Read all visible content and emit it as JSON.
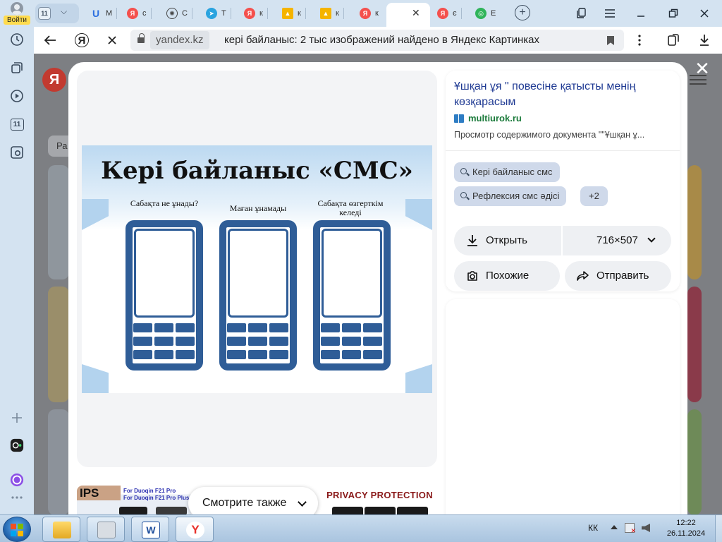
{
  "sidebar": {
    "login_label": "Войти",
    "badge_label": "11"
  },
  "tabs": {
    "first_count": "11",
    "items": [
      {
        "fav": "U",
        "label": "M",
        "style": "fav-u"
      },
      {
        "fav": "Я",
        "label": "с",
        "style": "fav-ya"
      },
      {
        "fav": "✺",
        "label": "C",
        "style": "fav-gpt"
      },
      {
        "fav": "➤",
        "label": "T",
        "style": "fav-tg"
      },
      {
        "fav": "Я",
        "label": "к",
        "style": "fav-ya"
      },
      {
        "fav": "▲",
        "label": "к",
        "style": "fav-img"
      },
      {
        "fav": "▲",
        "label": "к",
        "style": "fav-img"
      },
      {
        "fav": "Я",
        "label": "к",
        "style": "fav-ya"
      }
    ],
    "after_active": [
      {
        "fav": "Я",
        "label": "є",
        "style": "fav-ya"
      },
      {
        "fav": "◎",
        "label": "Е",
        "style": "fav-green"
      }
    ],
    "new_tab": "+"
  },
  "address": {
    "domain": "yandex.kz",
    "page_title": "кері байланыс: 2 тыс изображений найдено в Яндекс Картинках"
  },
  "page": {
    "filter_pill": "Ра"
  },
  "viewer": {
    "image": {
      "title": "Кері байланыс «СМС»",
      "columns": [
        "Сабақта не ұнады?",
        "Маған ұнамады",
        "Сабақта өзгерткім келеді"
      ]
    }
  },
  "also": {
    "button_label": "Смотрите также",
    "thumb1_badge": "IPS",
    "thumb1_line1": "For Duoqin F21 Pro",
    "thumb1_line2": "For Duoqin F21 Pro Plus",
    "thumb3_label": "PRIVACY PROTECTION"
  },
  "info": {
    "headline": "Ұшқан ұя \" повесіне қатысты менің көзқарасым",
    "source": "multiurok.ru",
    "description": "Просмотр содержимого документа \"\"Ұшқан ұ...",
    "chips": [
      "Кері байланыс смс",
      "Рефлексия смс әдісі"
    ],
    "more_chip": "+2",
    "open_label": "Открыть",
    "size_label": "716×507",
    "similar_label": "Похожие",
    "share_label": "Отправить"
  },
  "taskbar": {
    "lang": "КК",
    "time": "12:22",
    "date": "26.11.2024",
    "yandex_glyph": "Y",
    "word_glyph": "W"
  },
  "colors": {
    "accent_link": "#1f3a93",
    "source_green": "#1a7a3a",
    "phone_blue": "#2f5d97",
    "chip_bg": "#cfd9ea"
  }
}
